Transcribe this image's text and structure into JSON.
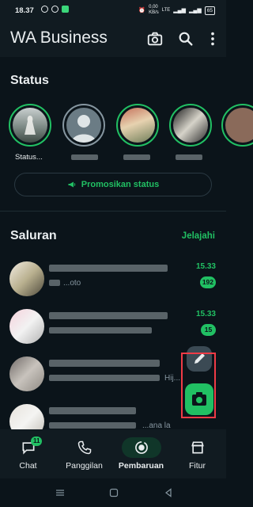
{
  "status_bar": {
    "time": "18.37",
    "network_speed": "0,00\nKB/s",
    "battery": "65"
  },
  "app_bar": {
    "title": "WA Business",
    "icons": [
      "camera-icon",
      "search-icon",
      "more-vert-icon"
    ]
  },
  "status": {
    "heading": "Status",
    "stories": [
      {
        "label": "Status..."
      },
      {
        "label": ""
      },
      {
        "label": ""
      },
      {
        "label": ""
      },
      {
        "label": ""
      }
    ],
    "promote_label": "Promosikan status"
  },
  "channels": {
    "heading": "Saluran",
    "explore_label": "Jelajahi",
    "items": [
      {
        "time": "15.33",
        "count": "192",
        "snippet": "...oto"
      },
      {
        "time": "15.33",
        "count": "15",
        "snippet": ""
      },
      {
        "time": "",
        "count": "",
        "snippet": "Hij..."
      },
      {
        "time": "",
        "count": "",
        "snippet": "...ana la"
      }
    ]
  },
  "fabs": {
    "edit": "pencil-icon",
    "camera": "camera-icon"
  },
  "bottom_nav": {
    "items": [
      {
        "label": "Chat",
        "badge": "11",
        "icon": "chat-icon"
      },
      {
        "label": "Panggilan",
        "icon": "phone-icon"
      },
      {
        "label": "Pembaruan",
        "icon": "updates-icon",
        "active": true
      },
      {
        "label": "Fitur",
        "icon": "store-icon"
      }
    ]
  },
  "colors": {
    "accent": "#21c063",
    "background": "#0b141a",
    "highlight": "#ef3b46"
  }
}
